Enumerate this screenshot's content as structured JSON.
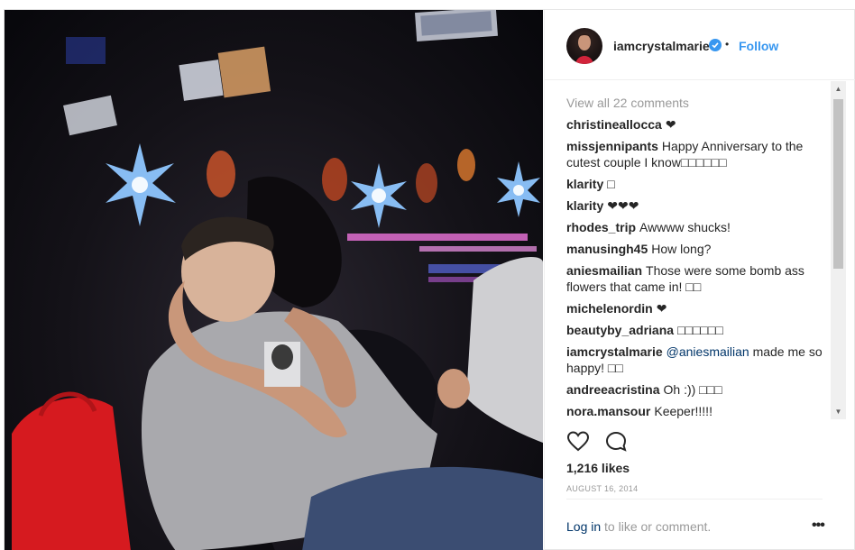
{
  "post": {
    "photo_alt": "",
    "author": {
      "username": "iamcrystalmarie",
      "verified": true,
      "separator": "•",
      "follow_label": "Follow"
    },
    "view_all_comments": "View all 22 comments",
    "comments": [
      {
        "user": "christineallocca",
        "text": "❤"
      },
      {
        "user": "missjennipants",
        "text": "Happy Anniversary to the cutest couple I know□□□□□□"
      },
      {
        "user": "klarity",
        "text": "□"
      },
      {
        "user": "klarity",
        "text": "❤❤❤"
      },
      {
        "user": "rhodes_trip",
        "text": "Awwww shucks!"
      },
      {
        "user": "manusingh45",
        "text": "How long?"
      },
      {
        "user": "aniesmailian",
        "text": "Those were some bomb ass flowers that came in! □□"
      },
      {
        "user": "michelenordin",
        "text": "❤"
      },
      {
        "user": "beautyby_adriana",
        "text": "□□□□□□"
      },
      {
        "user": "iamcrystalmarie",
        "mention": "@aniesmailian",
        "text": " made me so happy! □□"
      },
      {
        "user": "andreeacristina",
        "text": "Oh :)) □□□"
      },
      {
        "user": "nora.mansour",
        "text": "Keeper!!!!!"
      }
    ],
    "likes": "1,216 likes",
    "date": "AUGUST 16, 2014",
    "login_link": "Log in",
    "login_rest": " to like or comment.",
    "more_label": "•••",
    "icons": {
      "like": "heart-icon",
      "comment": "speech-bubble-icon",
      "verified": "verified-badge-icon",
      "more": "more-options-icon"
    },
    "colors": {
      "link_blue": "#3897f0",
      "mention_navy": "#003569",
      "muted": "#999999",
      "text": "#262626"
    }
  }
}
